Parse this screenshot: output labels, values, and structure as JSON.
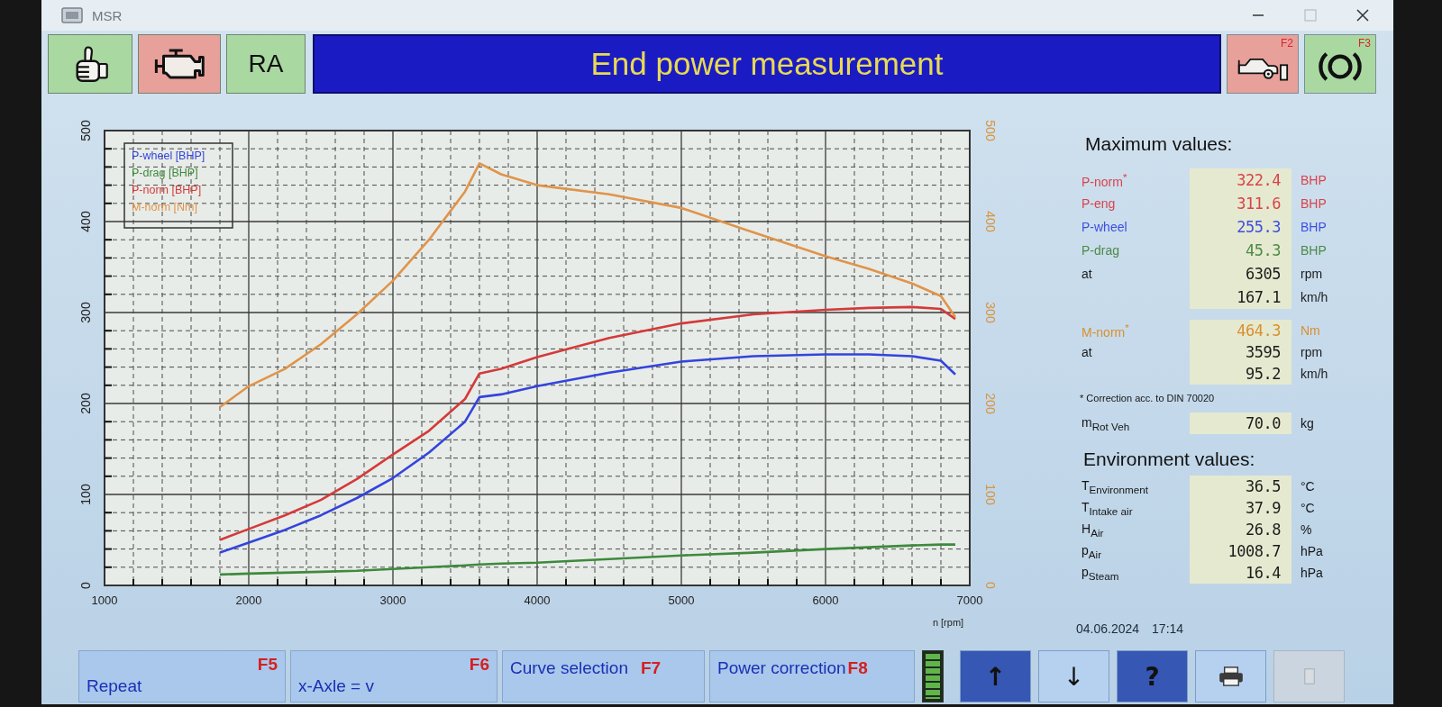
{
  "window": {
    "title": "MSR"
  },
  "toolbar_left": [
    {
      "kind": "thumbs-up",
      "color": "#a9d9a1"
    },
    {
      "kind": "engine",
      "color": "#e8a09a"
    },
    {
      "kind": "text",
      "label": "RA",
      "color": "#a9d9a1"
    }
  ],
  "header": {
    "title": "End power measurement"
  },
  "toolbar_right": [
    {
      "kind": "car-lift",
      "key": "F2",
      "color": "#e8a09a"
    },
    {
      "kind": "brake",
      "key": "F3",
      "color": "#a9d9a1"
    }
  ],
  "chart": {
    "chart_data": {
      "type": "line",
      "xlabel": "n [rpm]",
      "x": [
        1800,
        2000,
        2250,
        2500,
        2750,
        3000,
        3250,
        3500,
        3600,
        3750,
        4000,
        4500,
        5000,
        5500,
        6000,
        6300,
        6600,
        6800,
        6900
      ],
      "series": [
        {
          "name": "P-wheel [BHP]",
          "color": "#3344dd",
          "values": [
            36,
            47,
            61,
            77,
            96,
            118,
            146,
            180,
            207,
            210,
            219,
            234,
            246,
            252,
            254,
            254,
            252,
            247,
            232
          ]
        },
        {
          "name": "P-drag [BHP]",
          "color": "#3d8a3d",
          "values": [
            12,
            13,
            14,
            15,
            16,
            18,
            20,
            22,
            23,
            24,
            25,
            29,
            33,
            36,
            40,
            42,
            44,
            45,
            45
          ]
        },
        {
          "name": "P-norm [BHP]",
          "color": "#d43a3a",
          "values": [
            50,
            62,
            77,
            94,
            117,
            144,
            170,
            205,
            233,
            238,
            251,
            272,
            288,
            298,
            303,
            305,
            306,
            304,
            293
          ]
        },
        {
          "name": "M-norm [Nm]",
          "color": "#e0944a",
          "values": [
            196,
            219,
            238,
            265,
            298,
            335,
            380,
            433,
            464,
            452,
            440,
            430,
            415,
            388,
            362,
            348,
            332,
            318,
            295
          ]
        }
      ],
      "xlim": [
        1000,
        7000
      ],
      "ylim": [
        0,
        500
      ],
      "xticks": [
        1000,
        2000,
        3000,
        4000,
        5000,
        6000,
        7000
      ],
      "yticks": [
        0,
        100,
        200,
        300,
        400,
        500
      ],
      "grid": true
    },
    "right_axis_ticks": [
      "0",
      "100",
      "200",
      "300",
      "400",
      "500"
    ]
  },
  "maximum_values": {
    "title": "Maximum values:",
    "power_rows": [
      {
        "label": "P-norm$^{*}$",
        "value": "322.4",
        "unit": "BHP",
        "color": "#d9434a"
      },
      {
        "label": "P-eng",
        "value": "311.6",
        "unit": "BHP",
        "color": "#d9434a"
      },
      {
        "label": "P-wheel",
        "value": "255.3",
        "unit": "BHP",
        "color": "#3d4fe0"
      },
      {
        "label": "P-drag",
        "value": "45.3",
        "unit": "BHP",
        "color": "#4d8a45"
      },
      {
        "label": "at",
        "value": "6305",
        "unit": "rpm",
        "color": "#1c1c1c"
      },
      {
        "value": "167.1",
        "unit": "km/h",
        "color": "#1c1c1c"
      }
    ],
    "torque_rows": [
      {
        "label": "M-norm$^{*}$",
        "value": "464.3",
        "unit": "Nm",
        "color": "#d8902e"
      },
      {
        "label": "at",
        "value": "3595",
        "unit": "rpm",
        "color": "#1c1c1c"
      },
      {
        "value": "95.2",
        "unit": "km/h",
        "color": "#1c1c1c"
      }
    ],
    "footnote": "* Correction acc. to DIN 70020",
    "mass": {
      "label": "m$_{Rot Veh}$",
      "value": "70.0",
      "unit": "kg"
    }
  },
  "environment_values": {
    "title": "Environment values:",
    "rows": [
      {
        "label": "T$_{Environment}$",
        "value": "36.5",
        "unit": "°C"
      },
      {
        "label": "T$_{Intake air}$",
        "value": "37.9",
        "unit": "°C"
      },
      {
        "label": "H$_{Air}$",
        "value": "26.8",
        "unit": "%"
      },
      {
        "label": "p$_{Air}$",
        "value": "1008.7",
        "unit": "hPa"
      },
      {
        "label": "p$_{Steam}$",
        "value": "16.4",
        "unit": "hPa"
      }
    ]
  },
  "timestamp": {
    "date": "04.06.2024",
    "time": "17:14"
  },
  "function_keys": [
    {
      "kind": "stacked",
      "label": "Repeat",
      "key": "F5"
    },
    {
      "kind": "stacked",
      "label": "x-Axle = v",
      "key": "F6"
    },
    {
      "kind": "inline",
      "label": "Curve selection",
      "key": "F7"
    },
    {
      "kind": "inline",
      "label": "Power correction",
      "key": "F8"
    }
  ],
  "indicator": {
    "level": 1
  },
  "nav_buttons": [
    {
      "kind": "glyph",
      "label": "↑",
      "active": true,
      "disabled": false
    },
    {
      "kind": "glyph",
      "label": "↓",
      "active": false,
      "disabled": false
    },
    {
      "kind": "glyph",
      "label": "?",
      "active": true,
      "disabled": false
    },
    {
      "kind": "print",
      "active": false,
      "disabled": false
    },
    {
      "kind": "document",
      "active": false,
      "disabled": true
    }
  ]
}
